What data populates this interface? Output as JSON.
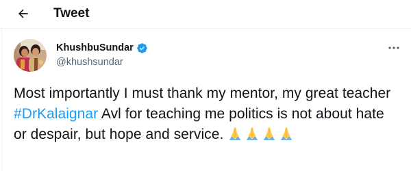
{
  "header": {
    "title": "Tweet",
    "back_icon": "arrow-left-icon"
  },
  "author": {
    "display_name": "KhushbuSundar",
    "handle": "@khushsundar",
    "verified": true,
    "verified_icon": "verified-badge-icon",
    "more_icon": "more-horizontal-icon"
  },
  "tweet": {
    "text_part1": "Most importantly I must thank my mentor, my great teacher ",
    "hashtag": "#DrKalaignar",
    "text_part2": " Avl for teaching me politics is not about hate or despair, but hope and service. ",
    "emoji_name": "folded-hands-emoji",
    "emoji_count": 4
  },
  "colors": {
    "accent": "#1d9bf0",
    "text": "#0f1419",
    "secondary_text": "#536471",
    "divider": "#eff3f4"
  }
}
